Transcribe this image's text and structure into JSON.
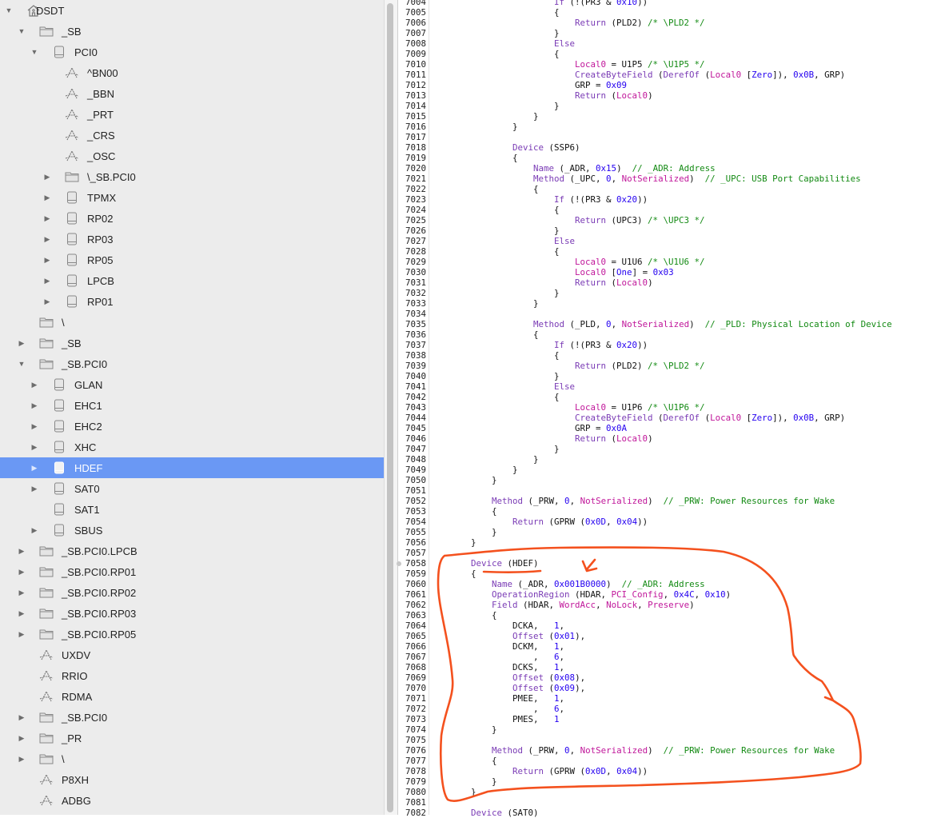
{
  "tree": [
    {
      "label": "DSDT",
      "level": 0,
      "icon": "home-icon",
      "exp": "open"
    },
    {
      "label": "_SB",
      "level": 1,
      "icon": "folder-icon",
      "exp": "open"
    },
    {
      "label": "PCI0",
      "level": 2,
      "icon": "device-icon",
      "exp": "open"
    },
    {
      "label": "^BN00",
      "level": 3,
      "icon": "method-icon",
      "exp": "none"
    },
    {
      "label": "_BBN",
      "level": 3,
      "icon": "method-icon",
      "exp": "none"
    },
    {
      "label": "_PRT",
      "level": 3,
      "icon": "method-icon",
      "exp": "none"
    },
    {
      "label": "_CRS",
      "level": 3,
      "icon": "method-icon",
      "exp": "none"
    },
    {
      "label": "_OSC",
      "level": 3,
      "icon": "method-icon",
      "exp": "none"
    },
    {
      "label": "\\_SB.PCI0",
      "level": 3,
      "icon": "folder-icon",
      "exp": "closed"
    },
    {
      "label": "TPMX",
      "level": 3,
      "icon": "device-icon",
      "exp": "closed"
    },
    {
      "label": "RP02",
      "level": 3,
      "icon": "device-icon",
      "exp": "closed"
    },
    {
      "label": "RP03",
      "level": 3,
      "icon": "device-icon",
      "exp": "closed"
    },
    {
      "label": "RP05",
      "level": 3,
      "icon": "device-icon",
      "exp": "closed"
    },
    {
      "label": "LPCB",
      "level": 3,
      "icon": "device-icon",
      "exp": "closed"
    },
    {
      "label": "RP01",
      "level": 3,
      "icon": "device-icon",
      "exp": "closed"
    },
    {
      "label": "\\",
      "level": 1,
      "icon": "folder-icon",
      "exp": "none"
    },
    {
      "label": "_SB",
      "level": 1,
      "icon": "folder-icon",
      "exp": "closed"
    },
    {
      "label": "_SB.PCI0",
      "level": 1,
      "icon": "folder-icon",
      "exp": "open"
    },
    {
      "label": "GLAN",
      "level": 2,
      "icon": "device-icon",
      "exp": "closed"
    },
    {
      "label": "EHC1",
      "level": 2,
      "icon": "device-icon",
      "exp": "closed"
    },
    {
      "label": "EHC2",
      "level": 2,
      "icon": "device-icon",
      "exp": "closed"
    },
    {
      "label": "XHC",
      "level": 2,
      "icon": "device-icon",
      "exp": "closed"
    },
    {
      "label": "HDEF",
      "level": 2,
      "icon": "device-icon",
      "exp": "closed",
      "selected": true
    },
    {
      "label": "SAT0",
      "level": 2,
      "icon": "device-icon",
      "exp": "closed"
    },
    {
      "label": "SAT1",
      "level": 2,
      "icon": "device-icon",
      "exp": "none"
    },
    {
      "label": "SBUS",
      "level": 2,
      "icon": "device-icon",
      "exp": "closed"
    },
    {
      "label": "_SB.PCI0.LPCB",
      "level": 1,
      "icon": "folder-icon",
      "exp": "closed"
    },
    {
      "label": "_SB.PCI0.RP01",
      "level": 1,
      "icon": "folder-icon",
      "exp": "closed"
    },
    {
      "label": "_SB.PCI0.RP02",
      "level": 1,
      "icon": "folder-icon",
      "exp": "closed"
    },
    {
      "label": "_SB.PCI0.RP03",
      "level": 1,
      "icon": "folder-icon",
      "exp": "closed"
    },
    {
      "label": "_SB.PCI0.RP05",
      "level": 1,
      "icon": "folder-icon",
      "exp": "closed"
    },
    {
      "label": "UXDV",
      "level": 1,
      "icon": "method-icon",
      "exp": "none"
    },
    {
      "label": "RRIO",
      "level": 1,
      "icon": "method-icon",
      "exp": "none"
    },
    {
      "label": "RDMA",
      "level": 1,
      "icon": "method-icon",
      "exp": "none"
    },
    {
      "label": "_SB.PCI0",
      "level": 1,
      "icon": "folder-icon",
      "exp": "closed"
    },
    {
      "label": "_PR",
      "level": 1,
      "icon": "folder-icon",
      "exp": "closed"
    },
    {
      "label": "\\",
      "level": 1,
      "icon": "folder-icon",
      "exp": "closed"
    },
    {
      "label": "P8XH",
      "level": 1,
      "icon": "method-icon",
      "exp": "none"
    },
    {
      "label": "ADBG",
      "level": 1,
      "icon": "method-icon",
      "exp": "none"
    }
  ],
  "editor": {
    "first_line": 7004,
    "lines": [
      "                        If (!(PR3 & 0x10))",
      "                        {",
      "                            Return (PLD2) /* \\PLD2 */",
      "                        }",
      "                        Else",
      "                        {",
      "                            Local0 = U1P5 /* \\U1P5 */",
      "                            CreateByteField (DerefOf (Local0 [Zero]), 0x0B, GRP)",
      "                            GRP = 0x09",
      "                            Return (Local0)",
      "                        }",
      "                    }",
      "                }",
      "",
      "                Device (SSP6)",
      "                {",
      "                    Name (_ADR, 0x15)  // _ADR: Address",
      "                    Method (_UPC, 0, NotSerialized)  // _UPC: USB Port Capabilities",
      "                    {",
      "                        If (!(PR3 & 0x20))",
      "                        {",
      "                            Return (UPC3) /* \\UPC3 */",
      "                        }",
      "                        Else",
      "                        {",
      "                            Local0 = U1U6 /* \\U1U6 */",
      "                            Local0 [One] = 0x03",
      "                            Return (Local0)",
      "                        }",
      "                    }",
      "",
      "                    Method (_PLD, 0, NotSerialized)  // _PLD: Physical Location of Device",
      "                    {",
      "                        If (!(PR3 & 0x20))",
      "                        {",
      "                            Return (PLD2) /* \\PLD2 */",
      "                        }",
      "                        Else",
      "                        {",
      "                            Local0 = U1P6 /* \\U1P6 */",
      "                            CreateByteField (DerefOf (Local0 [Zero]), 0x0B, GRP)",
      "                            GRP = 0x0A",
      "                            Return (Local0)",
      "                        }",
      "                    }",
      "                }",
      "            }",
      "",
      "            Method (_PRW, 0, NotSerialized)  // _PRW: Power Resources for Wake",
      "            {",
      "                Return (GPRW (0x0D, 0x04))",
      "            }",
      "        }",
      "",
      "        Device (HDEF)",
      "        {",
      "            Name (_ADR, 0x001B0000)  // _ADR: Address",
      "            OperationRegion (HDAR, PCI_Config, 0x4C, 0x10)",
      "            Field (HDAR, WordAcc, NoLock, Preserve)",
      "            {",
      "                DCKA,   1,",
      "                Offset (0x01),",
      "                DCKM,   1,",
      "                    ,   6,",
      "                DCKS,   1,",
      "                Offset (0x08),",
      "                Offset (0x09),",
      "                PMEE,   1,",
      "                    ,   6,",
      "                PMES,   1",
      "            }",
      "",
      "            Method (_PRW, 0, NotSerialized)  // _PRW: Power Resources for Wake",
      "            {",
      "                Return (GPRW (0x0D, 0x04))",
      "            }",
      "        }",
      "",
      "        Device (SAT0)"
    ]
  },
  "colors": {
    "selection": "#6a98f4",
    "annotation": "#f4511e",
    "keyword": "#7a3bb5",
    "constant": "#c0169a",
    "number": "#2400f0",
    "comment": "#138a13"
  }
}
